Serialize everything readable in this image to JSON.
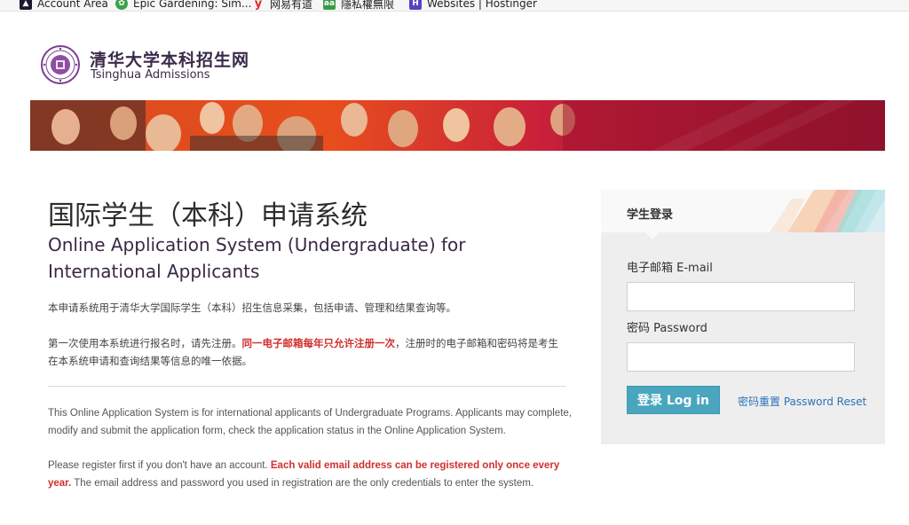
{
  "bookmarks": [
    {
      "label": "Account Area",
      "icon": "account-icon"
    },
    {
      "label": "Epic Gardening: Sim...",
      "icon": "leaf-icon"
    },
    {
      "label": "网易有道",
      "icon": "youdao-icon"
    },
    {
      "label": "隱私權無限",
      "icon": "aa-icon"
    },
    {
      "label": "Websites | Hostinger",
      "icon": "hostinger-icon"
    }
  ],
  "header": {
    "site_name_cn": "清华大学本科招生网",
    "site_name_en": "Tsinghua Admissions"
  },
  "main": {
    "title_cn": "国际学生（本科）申请系统",
    "title_en": "Online Application System (Undergraduate) for International Applicants",
    "para1_cn": "本申请系统用于清华大学国际学生（本科）招生信息采集，包括申请、管理和结果查询等。",
    "para2_cn_a": "第一次使用本系统进行报名时，请先注册。",
    "para2_cn_red": "同一电子邮箱每年只允许注册一次",
    "para2_cn_b": "，注册时的电子邮箱和密码将是考生在本系统申请和查询结果等信息的唯一依据。",
    "para1_en": "This Online Application System is for international applicants of Undergraduate Programs. Applicants may complete, modify and submit the application form, check the application status in the Online Application System.",
    "para2_en_a": "Please register first if you don't have an account. ",
    "para2_en_red": "Each valid email address can be registered only once every year.",
    "para2_en_b": " The email address and password you used in registration are the only credentials to enter the system."
  },
  "login": {
    "title": "学生登录",
    "email_label": "电子邮箱 E-mail",
    "email_value": "",
    "password_label": "密码 Password",
    "password_value": "",
    "login_button": "登录 Log in",
    "reset_link": "密码重置 Password Reset"
  },
  "colors": {
    "accent": "#4aa6bf",
    "brand_purple": "#3b2a4a",
    "warning_red": "#d0302c",
    "link_blue": "#2a73b8"
  }
}
